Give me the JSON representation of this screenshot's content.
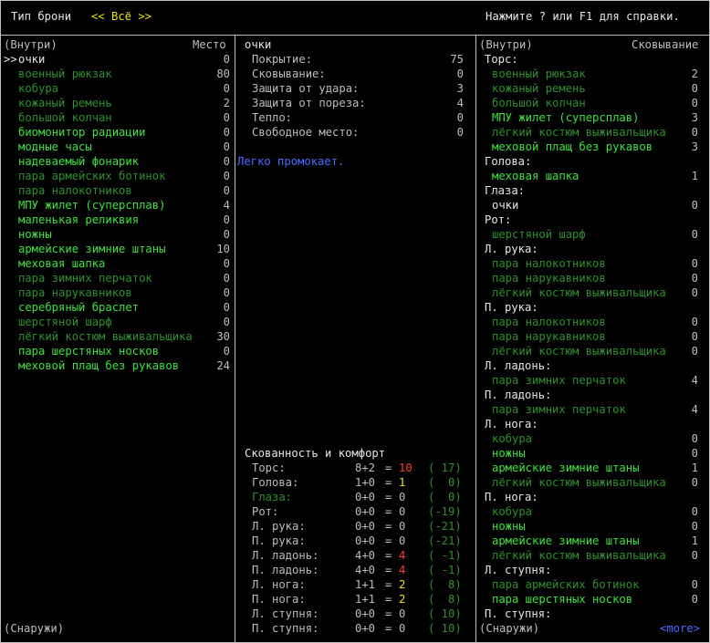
{
  "header": {
    "title": "Тип брони",
    "filter": "<< Всё >>",
    "help": "Нажмите ? или F1 для справки."
  },
  "left": {
    "header_left": "(Внутри)",
    "header_right": "Место",
    "footer": "(Снаружи)",
    "items": [
      {
        "cursor": ">>",
        "name": "очки",
        "value": "0",
        "color": "white"
      },
      {
        "cursor": "",
        "name": "военный рюкзак",
        "value": "80",
        "color": "dgreen"
      },
      {
        "cursor": "",
        "name": "кобура",
        "value": "0",
        "color": "dgreen"
      },
      {
        "cursor": "",
        "name": "кожаный ремень",
        "value": "2",
        "color": "dgreen"
      },
      {
        "cursor": "",
        "name": "большой колчан",
        "value": "0",
        "color": "dgreen"
      },
      {
        "cursor": "",
        "name": "биомонитор радиации",
        "value": "0",
        "color": "green"
      },
      {
        "cursor": "",
        "name": "модные часы",
        "value": "0",
        "color": "green"
      },
      {
        "cursor": "",
        "name": "надеваемый фонарик",
        "value": "0",
        "color": "green"
      },
      {
        "cursor": "",
        "name": "пара армейских ботинок",
        "value": "0",
        "color": "dgreen"
      },
      {
        "cursor": "",
        "name": "пара налокотников",
        "value": "0",
        "color": "dgreen"
      },
      {
        "cursor": "",
        "name": "МПУ жилет (суперсплав)",
        "value": "4",
        "color": "green"
      },
      {
        "cursor": "",
        "name": "маленькая реликвия",
        "value": "0",
        "color": "green"
      },
      {
        "cursor": "",
        "name": "ножны",
        "value": "0",
        "color": "green"
      },
      {
        "cursor": "",
        "name": "армейские зимние штаны",
        "value": "10",
        "color": "green"
      },
      {
        "cursor": "",
        "name": "меховая шапка",
        "value": "0",
        "color": "green"
      },
      {
        "cursor": "",
        "name": "пара зимних перчаток",
        "value": "0",
        "color": "dgreen"
      },
      {
        "cursor": "",
        "name": "пара нарукавников",
        "value": "0",
        "color": "dgreen"
      },
      {
        "cursor": "",
        "name": "серебряный браслет",
        "value": "0",
        "color": "green"
      },
      {
        "cursor": "",
        "name": "шерстяной шарф",
        "value": "0",
        "color": "dgreen"
      },
      {
        "cursor": "",
        "name": "лёгкий костюм выживальщика",
        "value": "30",
        "color": "dgreen"
      },
      {
        "cursor": "",
        "name": "пара шерстяных носков",
        "value": "0",
        "color": "green"
      },
      {
        "cursor": "",
        "name": "меховой плащ без рукавов",
        "value": "24",
        "color": "green"
      }
    ]
  },
  "middle": {
    "item_name": "очки",
    "stats": [
      {
        "label": "Покрытие:",
        "value": "75"
      },
      {
        "label": "Сковывание:",
        "value": "0"
      },
      {
        "label": "Защита от удара:",
        "value": "3"
      },
      {
        "label": "Защита от пореза:",
        "value": "4"
      },
      {
        "label": "Тепло:",
        "value": "0"
      },
      {
        "label": "Свободное место:",
        "value": "0"
      }
    ],
    "description": "Легко промокает.",
    "comfort_title": "Скованность и комфорт",
    "comfort": [
      {
        "label": "Торс:",
        "label_color": "gray",
        "a": "8+2",
        "eq": "=",
        "res": "10",
        "res_color": "red",
        "warm": "( 17)"
      },
      {
        "label": "Голова:",
        "label_color": "gray",
        "a": "1+0",
        "eq": "=",
        "res": "1",
        "res_color": "yellow",
        "warm": "(  0)"
      },
      {
        "label": "Глаза:",
        "label_color": "dgreen",
        "a": "0+0",
        "eq": "=",
        "res": "0",
        "res_color": "gray",
        "warm": "(  0)"
      },
      {
        "label": "Рот:",
        "label_color": "gray",
        "a": "0+0",
        "eq": "=",
        "res": "0",
        "res_color": "gray",
        "warm": "(-19)"
      },
      {
        "label": "Л. рука:",
        "label_color": "gray",
        "a": "0+0",
        "eq": "=",
        "res": "0",
        "res_color": "gray",
        "warm": "(-21)"
      },
      {
        "label": "П. рука:",
        "label_color": "gray",
        "a": "0+0",
        "eq": "=",
        "res": "0",
        "res_color": "gray",
        "warm": "(-21)"
      },
      {
        "label": "Л. ладонь:",
        "label_color": "gray",
        "a": "4+0",
        "eq": "=",
        "res": "4",
        "res_color": "red",
        "warm": "( -1)"
      },
      {
        "label": "П. ладонь:",
        "label_color": "gray",
        "a": "4+0",
        "eq": "=",
        "res": "4",
        "res_color": "red",
        "warm": "( -1)"
      },
      {
        "label": "Л. нога:",
        "label_color": "gray",
        "a": "1+1",
        "eq": "=",
        "res": "2",
        "res_color": "yellow",
        "warm": "(  8)"
      },
      {
        "label": "П. нога:",
        "label_color": "gray",
        "a": "1+1",
        "eq": "=",
        "res": "2",
        "res_color": "yellow",
        "warm": "(  8)"
      },
      {
        "label": "Л. ступня:",
        "label_color": "gray",
        "a": "0+0",
        "eq": "=",
        "res": "0",
        "res_color": "gray",
        "warm": "( 10)"
      },
      {
        "label": "П. ступня:",
        "label_color": "gray",
        "a": "0+0",
        "eq": "=",
        "res": "0",
        "res_color": "gray",
        "warm": "( 10)"
      }
    ]
  },
  "right": {
    "header_left": "(Внутри)",
    "header_right": "Сковывание",
    "footer": "(Снаружи)",
    "more": "<more>",
    "rows": [
      {
        "type": "section",
        "text": "Торс:"
      },
      {
        "type": "item",
        "text": "военный рюкзак",
        "value": "2",
        "color": "dgreen"
      },
      {
        "type": "item",
        "text": "кожаный ремень",
        "value": "0",
        "color": "dgreen"
      },
      {
        "type": "item",
        "text": "большой колчан",
        "value": "0",
        "color": "dgreen"
      },
      {
        "type": "item",
        "text": "МПУ жилет (суперсплав)",
        "value": "3",
        "color": "green"
      },
      {
        "type": "item",
        "text": "лёгкий костюм выживальщика",
        "value": "0",
        "color": "dgreen"
      },
      {
        "type": "item",
        "text": "меховой плащ без рукавов",
        "value": "3",
        "color": "green"
      },
      {
        "type": "section",
        "text": "Голова:"
      },
      {
        "type": "item",
        "text": "меховая шапка",
        "value": "1",
        "color": "green"
      },
      {
        "type": "section",
        "text": "Глаза:"
      },
      {
        "type": "item",
        "text": "очки",
        "value": "0",
        "color": "white"
      },
      {
        "type": "section",
        "text": "Рот:"
      },
      {
        "type": "item",
        "text": "шерстяной шарф",
        "value": "0",
        "color": "dgreen"
      },
      {
        "type": "section",
        "text": "Л. рука:"
      },
      {
        "type": "item",
        "text": "пара налокотников",
        "value": "0",
        "color": "dgreen"
      },
      {
        "type": "item",
        "text": "пара нарукавников",
        "value": "0",
        "color": "dgreen"
      },
      {
        "type": "item",
        "text": "лёгкий костюм выживальщика",
        "value": "0",
        "color": "dgreen"
      },
      {
        "type": "section",
        "text": "П. рука:"
      },
      {
        "type": "item",
        "text": "пара налокотников",
        "value": "0",
        "color": "dgreen"
      },
      {
        "type": "item",
        "text": "пара нарукавников",
        "value": "0",
        "color": "dgreen"
      },
      {
        "type": "item",
        "text": "лёгкий костюм выживальщика",
        "value": "0",
        "color": "dgreen"
      },
      {
        "type": "section",
        "text": "Л. ладонь:"
      },
      {
        "type": "item",
        "text": "пара зимних перчаток",
        "value": "4",
        "color": "dgreen"
      },
      {
        "type": "section",
        "text": "П. ладонь:"
      },
      {
        "type": "item",
        "text": "пара зимних перчаток",
        "value": "4",
        "color": "dgreen"
      },
      {
        "type": "section",
        "text": "Л. нога:"
      },
      {
        "type": "item",
        "text": "кобура",
        "value": "0",
        "color": "dgreen"
      },
      {
        "type": "item",
        "text": "ножны",
        "value": "0",
        "color": "green"
      },
      {
        "type": "item",
        "text": "армейские зимние штаны",
        "value": "1",
        "color": "green"
      },
      {
        "type": "item",
        "text": "лёгкий костюм выживальщика",
        "value": "0",
        "color": "dgreen"
      },
      {
        "type": "section",
        "text": "П. нога:"
      },
      {
        "type": "item",
        "text": "кобура",
        "value": "0",
        "color": "dgreen"
      },
      {
        "type": "item",
        "text": "ножны",
        "value": "0",
        "color": "green"
      },
      {
        "type": "item",
        "text": "армейские зимние штаны",
        "value": "1",
        "color": "green"
      },
      {
        "type": "item",
        "text": "лёгкий костюм выживальщика",
        "value": "0",
        "color": "dgreen"
      },
      {
        "type": "section",
        "text": "Л. ступня:"
      },
      {
        "type": "item",
        "text": "пара армейских ботинок",
        "value": "0",
        "color": "dgreen"
      },
      {
        "type": "item",
        "text": "пара шерстяных носков",
        "value": "0",
        "color": "green"
      },
      {
        "type": "section",
        "text": "П. ступня:"
      }
    ]
  },
  "colors": {
    "green": "#3ee13e",
    "dark_green": "#2f8f2f",
    "gray": "#bdbdbd",
    "red": "#ff3b3b",
    "yellow": "#e6e600",
    "blue": "#4a6cff"
  }
}
